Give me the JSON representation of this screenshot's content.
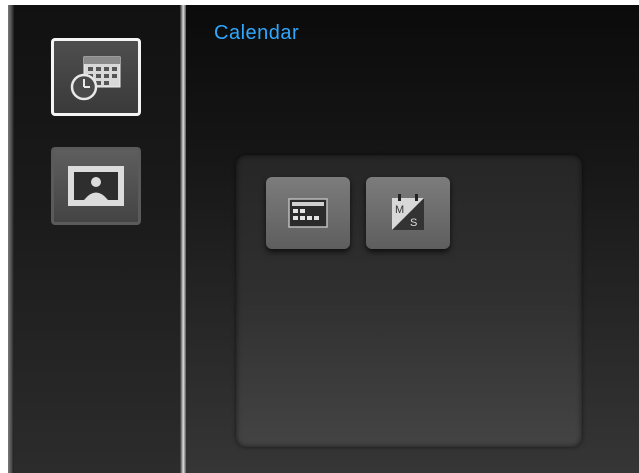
{
  "header": {
    "title": "Calendar"
  },
  "sidebar": {
    "items": [
      {
        "icon": "calendar-clock-icon",
        "selected": true
      },
      {
        "icon": "photo-icon",
        "selected": false
      }
    ]
  },
  "panel": {
    "options": [
      {
        "icon": "month-calendar-icon"
      },
      {
        "icon": "monday-sunday-start-icon"
      }
    ]
  },
  "colors": {
    "title": "#2fa7ff",
    "selected_border": "#f4f4f4"
  }
}
